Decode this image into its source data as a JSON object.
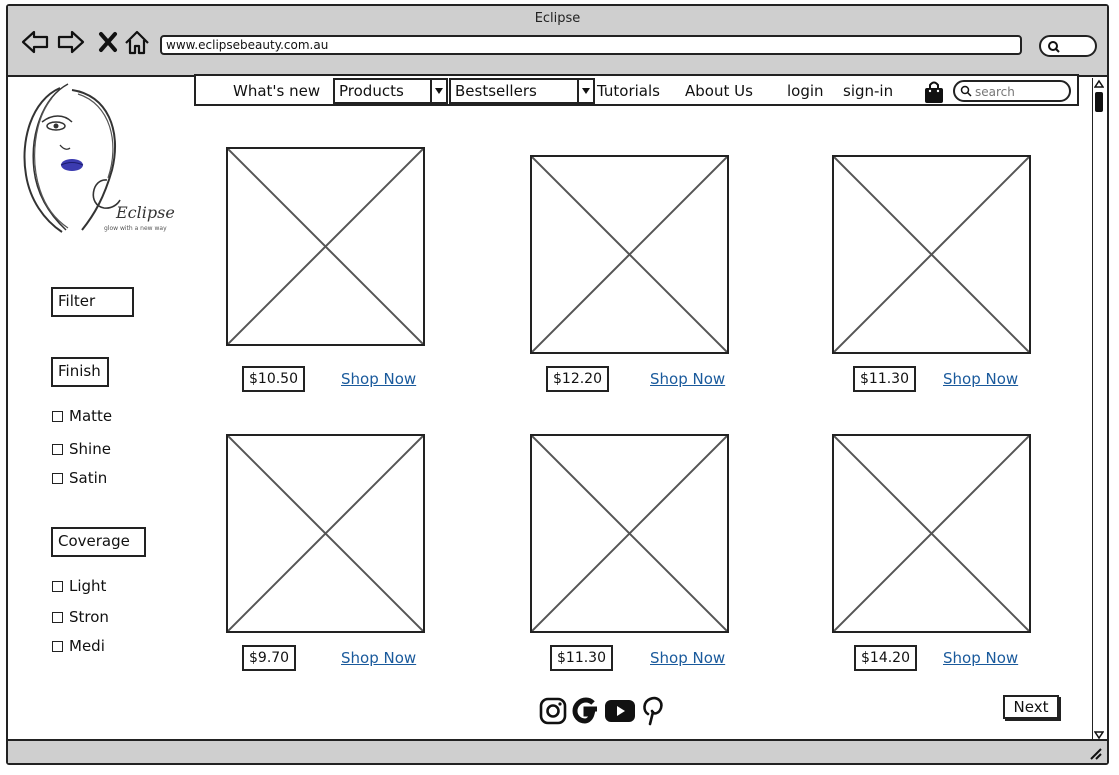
{
  "window": {
    "title": "Eclipse"
  },
  "browser": {
    "url": "www.eclipsebeauty.com.au"
  },
  "nav": {
    "whats_new": "What's new",
    "products": "Products",
    "bestsellers": "Bestsellers",
    "tutorials": "Tutorials",
    "about_us": "About Us",
    "login": "login",
    "sign_in": "sign-in",
    "search_placeholder": "search"
  },
  "logo": {
    "name": "Eclipse",
    "tagline": "glow with a new way"
  },
  "filters": {
    "heading": "Filter",
    "finish": {
      "label": "Finish",
      "options": [
        "Matte",
        "Shine",
        "Satin"
      ]
    },
    "coverage": {
      "label": "Coverage",
      "options": [
        "Light",
        "Stron",
        "Medi"
      ]
    }
  },
  "products": [
    {
      "price": "$10.50",
      "link": "Shop Now"
    },
    {
      "price": "$12.20",
      "link": "Shop Now"
    },
    {
      "price": "$11.30",
      "link": "Shop Now"
    },
    {
      "price": "$9.70",
      "link": "Shop Now"
    },
    {
      "price": "$11.30",
      "link": "Shop Now"
    },
    {
      "price": "$14.20",
      "link": "Shop Now"
    }
  ],
  "social_icons": [
    "instagram-icon",
    "google-icon",
    "youtube-icon",
    "pinterest-icon"
  ],
  "pagination": {
    "next": "Next"
  },
  "colors": {
    "link": "#1a5a9c",
    "chrome": "#cfcfcf",
    "lips": "#3b3bb0"
  }
}
